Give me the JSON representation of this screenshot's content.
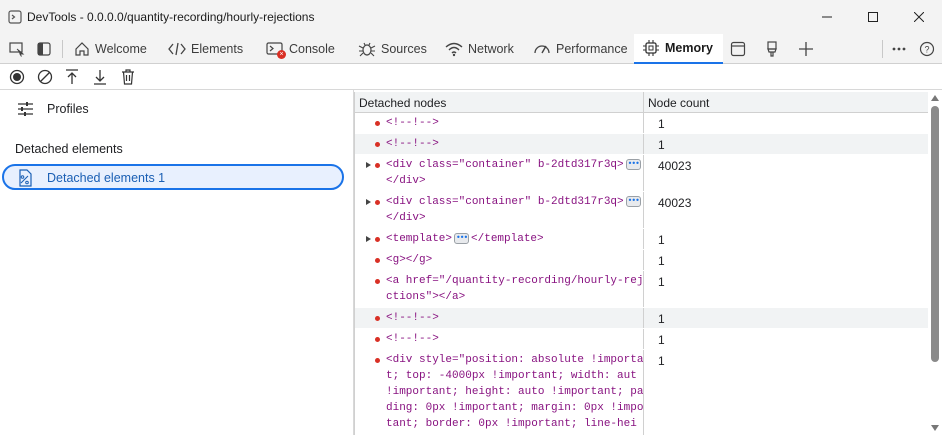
{
  "window": {
    "title": "DevTools - 0.0.0.0/quantity-recording/hourly-rejections"
  },
  "tabs": [
    {
      "label": "Welcome",
      "icon": "home-icon"
    },
    {
      "label": "Elements",
      "icon": "code-brackets-icon"
    },
    {
      "label": "Console",
      "icon": "console-icon"
    },
    {
      "label": "Sources",
      "icon": "bug-icon"
    },
    {
      "label": "Network",
      "icon": "wifi-icon"
    },
    {
      "label": "Performance",
      "icon": "gauge-icon"
    },
    {
      "label": "Memory",
      "icon": "chip-icon",
      "active": true
    }
  ],
  "sidebar": {
    "profiles_label": "Profiles",
    "section_heading": "Detached elements",
    "selected_item": "Detached elements 1"
  },
  "grid": {
    "headers": [
      "Detached nodes",
      "Node count"
    ],
    "rows": [
      {
        "lines": [
          "<!--!-->"
        ],
        "count": "1",
        "expandable": false,
        "alt": false
      },
      {
        "lines": [
          "<!--!-->"
        ],
        "count": "1",
        "expandable": false,
        "alt": true
      },
      {
        "lines": [
          "<div class=\"container\" b-2dtd317r3q>",
          "</div>"
        ],
        "count": "40023",
        "expandable": true,
        "alt": false,
        "dots": true
      },
      {
        "lines": [
          "<div class=\"container\" b-2dtd317r3q>",
          "</div>"
        ],
        "count": "40023",
        "expandable": true,
        "alt": false,
        "dots": true
      },
      {
        "lines": [
          "<template>",
          "</template>"
        ],
        "count": "1",
        "expandable": true,
        "alt": false,
        "dots_inline": true
      },
      {
        "lines": [
          "<g></g>"
        ],
        "count": "1",
        "expandable": false,
        "alt": false
      },
      {
        "lines": [
          "<a href=\"/quantity-recording/hourly-rej",
          "ctions\"></a>"
        ],
        "count": "1",
        "expandable": false,
        "alt": false
      },
      {
        "lines": [
          "<!--!-->"
        ],
        "count": "1",
        "expandable": false,
        "alt": true
      },
      {
        "lines": [
          "<!--!-->"
        ],
        "count": "1",
        "expandable": false,
        "alt": false
      },
      {
        "lines": [
          "<div style=\"position: absolute !importa",
          "t; top: -4000px !important; width: aut",
          "!important; height: auto !important; pa",
          "ding: 0px !important; margin: 0px !impo",
          "tant; border: 0px !important; line-hei"
        ],
        "count": "1",
        "expandable": false,
        "alt": false
      }
    ]
  }
}
